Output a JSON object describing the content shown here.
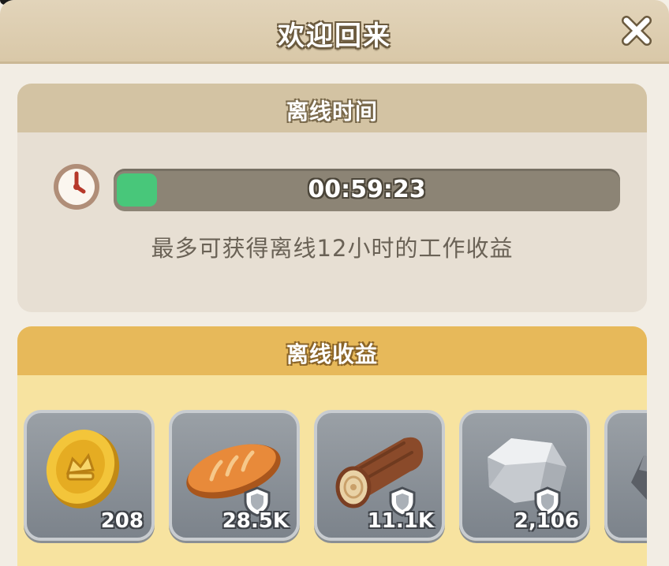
{
  "dialog": {
    "title": "欢迎回来",
    "close_icon": "close-x-icon"
  },
  "offline_time": {
    "title": "离线时间",
    "clock_icon": "clock-icon",
    "timer": "00:59:23",
    "progress_fraction": 0.08,
    "note": "最多可获得离线12小时的工作收益"
  },
  "offline_rewards": {
    "title": "离线收益",
    "items": [
      {
        "icon": "gold-coin-icon",
        "count": "208",
        "shield": false
      },
      {
        "icon": "bread-icon",
        "count": "28.5K",
        "shield": true
      },
      {
        "icon": "wood-log-icon",
        "count": "11.1K",
        "shield": true
      },
      {
        "icon": "stone-icon",
        "count": "2,106",
        "shield": true
      },
      {
        "icon": "ore-icon",
        "count": "",
        "shield": false
      }
    ]
  },
  "colors": {
    "progress_fill": "#48c77a",
    "rewards_header": "#e7b95a",
    "time_header": "#d3c3a3"
  }
}
